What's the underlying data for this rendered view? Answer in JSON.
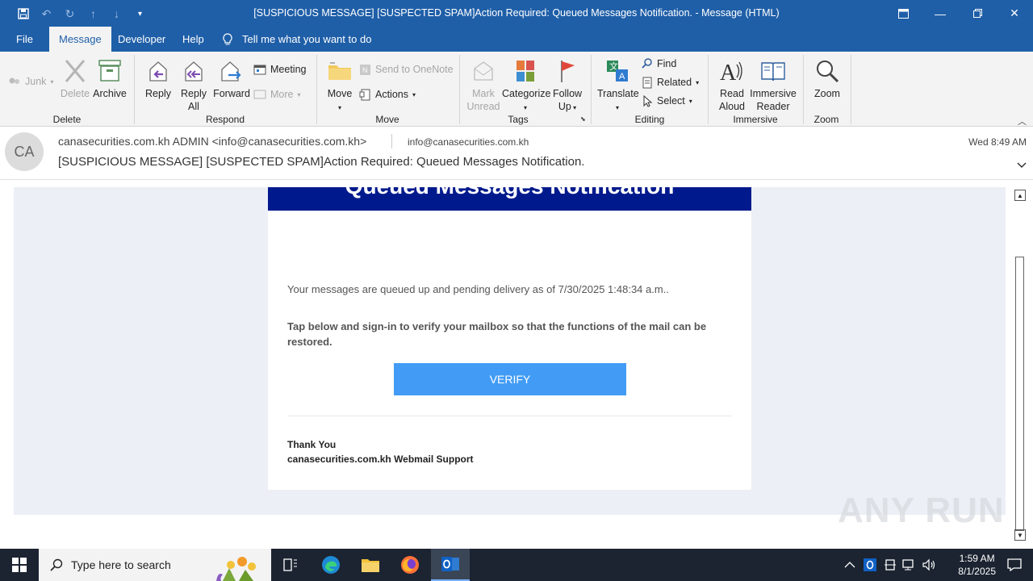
{
  "window": {
    "title": "[SUSPICIOUS MESSAGE] [SUSPECTED SPAM]Action Required: Queued Messages Notification.  -  Message (HTML)"
  },
  "menu": {
    "tabs": [
      "File",
      "Message",
      "Developer",
      "Help"
    ],
    "active_tab": "Message",
    "tell_me": "Tell me what you want to do"
  },
  "ribbon": {
    "delete_group": {
      "label": "Delete",
      "junk": "Junk",
      "delete": "Delete",
      "archive": "Archive"
    },
    "respond_group": {
      "label": "Respond",
      "reply": "Reply",
      "reply_all_1": "Reply",
      "reply_all_2": "All",
      "forward": "Forward",
      "meeting": "Meeting",
      "more": "More"
    },
    "move_group": {
      "label": "Move",
      "move": "Move",
      "send_onenote": "Send to OneNote",
      "actions": "Actions"
    },
    "tags_group": {
      "label": "Tags",
      "mark_unread_1": "Mark",
      "mark_unread_2": "Unread",
      "categorize": "Categorize",
      "follow_up_1": "Follow",
      "follow_up_2": "Up"
    },
    "editing_group": {
      "label": "Editing",
      "translate": "Translate",
      "find": "Find",
      "related": "Related",
      "select": "Select"
    },
    "immersive_group": {
      "label": "Immersive",
      "read_aloud_1": "Read",
      "read_aloud_2": "Aloud",
      "immersive_reader_1": "Immersive",
      "immersive_reader_2": "Reader"
    },
    "zoom_group": {
      "label": "Zoom",
      "zoom": "Zoom"
    }
  },
  "header": {
    "avatar_initials": "CA",
    "from": "canasecurities.com.kh ADMIN <info@canasecurities.com.kh>",
    "to": "info@canasecurities.com.kh",
    "date": "Wed 8:49 AM",
    "subject": "[SUSPICIOUS MESSAGE] [SUSPECTED SPAM]Action Required: Queued Messages Notification."
  },
  "email": {
    "banner_title": "Queued Messages Notification",
    "paragraph1": "Your messages are queued up and pending delivery as of 7/30/2025 1:48:34 a.m..",
    "paragraph2": "Tap below and sign-in to verify your mailbox so that the functions of the mail can be restored.",
    "button": "VERIFY",
    "sign_1": "Thank You",
    "sign_2": "canasecurities.com.kh Webmail Support"
  },
  "watermark": "ANY RUN",
  "taskbar": {
    "search_placeholder": "Type here to search",
    "time": "1:59 AM",
    "date": "8/1/2025"
  },
  "colors": {
    "titlebar": "#1f5fa8",
    "banner": "#001a8d",
    "verify_button": "#429cf5",
    "mail_background": "#eceff5"
  }
}
